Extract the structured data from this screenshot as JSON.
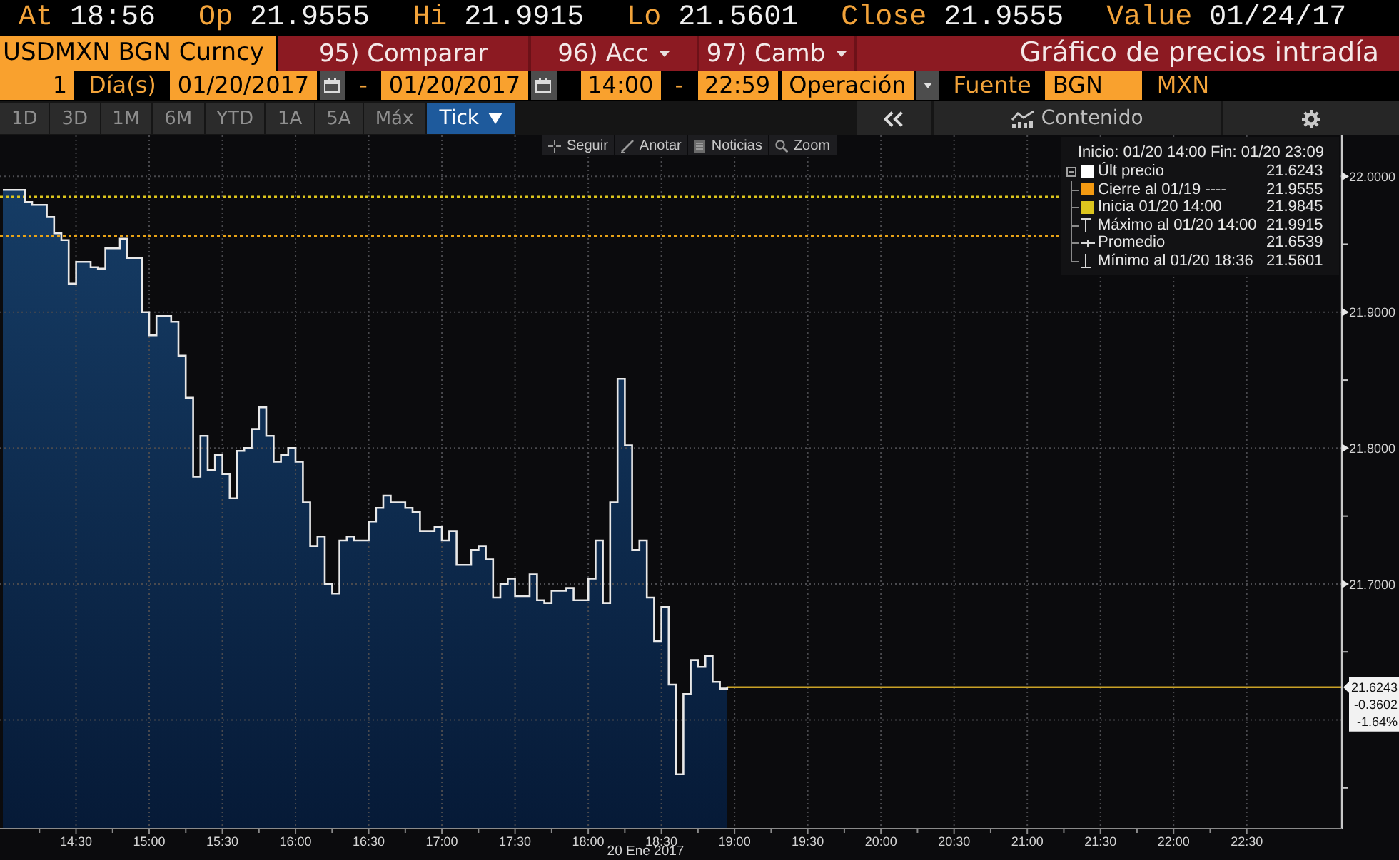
{
  "quote": [
    {
      "label": "At",
      "value": "18:56"
    },
    {
      "label": "Op",
      "value": "21.9555"
    },
    {
      "label": "Hi",
      "value": "21.9915"
    },
    {
      "label": "Lo",
      "value": "21.5601"
    },
    {
      "label": "Close",
      "value": "21.9555"
    },
    {
      "label": "Value",
      "value": "01/24/17"
    }
  ],
  "header": {
    "security": "USDMXN BGN Curncy",
    "menu": [
      {
        "label": "95) Comparar",
        "dropdown": false
      },
      {
        "label": "96) Acc",
        "dropdown": true
      },
      {
        "label": "97) Camb",
        "dropdown": true
      }
    ],
    "title": "Gráfico de precios intradía"
  },
  "range_bar": [
    {
      "kind": "field",
      "text": "1"
    },
    {
      "kind": "label",
      "text": "Día(s)"
    },
    {
      "kind": "date",
      "text": "01/20/2017"
    },
    {
      "kind": "label",
      "text": "-"
    },
    {
      "kind": "date",
      "text": "01/20/2017"
    },
    {
      "kind": "field",
      "text": "14:00"
    },
    {
      "kind": "label",
      "text": "-"
    },
    {
      "kind": "field",
      "text": "22:59"
    },
    {
      "kind": "select",
      "text": "Operación"
    },
    {
      "kind": "label",
      "text": "Fuente"
    },
    {
      "kind": "field",
      "text": "BGN"
    },
    {
      "kind": "label",
      "text": "MXN"
    }
  ],
  "periods": [
    {
      "label": "1D",
      "selected": false,
      "dropdown": false
    },
    {
      "label": "3D",
      "selected": false,
      "dropdown": false
    },
    {
      "label": "1M",
      "selected": false,
      "dropdown": false
    },
    {
      "label": "6M",
      "selected": false,
      "dropdown": false
    },
    {
      "label": "YTD",
      "selected": false,
      "dropdown": false
    },
    {
      "label": "1A",
      "selected": false,
      "dropdown": false
    },
    {
      "label": "5A",
      "selected": false,
      "dropdown": false
    },
    {
      "label": "Máx",
      "selected": false,
      "dropdown": false
    },
    {
      "label": "Tick",
      "selected": true,
      "dropdown": true
    }
  ],
  "view_bar": {
    "content_button": "Contenido"
  },
  "chart": {
    "tools": [
      {
        "kind": "follow",
        "label": "Seguir"
      },
      {
        "kind": "annotate",
        "label": "Anotar"
      },
      {
        "kind": "news",
        "label": "Noticias"
      },
      {
        "kind": "zoom",
        "label": "Zoom"
      }
    ],
    "legend": {
      "header": "Inicio: 01/20 14:00 Fin: 01/20 23:09",
      "items": [
        {
          "kind": "swatch",
          "color": "#ffffff",
          "label": "Últ precio",
          "value": "21.6243"
        },
        {
          "kind": "swatch",
          "color": "#f39a12",
          "label": "Cierre al 01/19 ----",
          "value": "21.9555"
        },
        {
          "kind": "swatch",
          "color": "#dcc51e",
          "label": "Inicia 01/20 14:00",
          "value": "21.9845"
        },
        {
          "kind": "high",
          "label": "Máximo al 01/20 14:00",
          "value": "21.9915"
        },
        {
          "kind": "average",
          "label": "Promedio",
          "value": "21.6539"
        },
        {
          "kind": "low",
          "label": "Mínimo al 01/20 18:36",
          "value": "21.5601"
        }
      ]
    },
    "last_price_tag": [
      "21.6243",
      "-0.3602",
      "-1.64%"
    ],
    "chart_data": {
      "type": "area",
      "xlabel": "20 Ene 2017",
      "categories": [
        null,
        null,
        null,
        null,
        null,
        null,
        null,
        null,
        null,
        null,
        "14:30",
        null,
        null,
        null,
        null,
        null,
        null,
        null,
        null,
        null,
        "15:00",
        null,
        null,
        null,
        null,
        null,
        null,
        null,
        null,
        null,
        "15:30",
        null,
        null,
        null,
        null,
        null,
        null,
        null,
        null,
        null,
        "16:00",
        null,
        null,
        null,
        null,
        null,
        null,
        null,
        null,
        null,
        "16:30",
        null,
        null,
        null,
        null,
        null,
        null,
        null,
        null,
        null,
        "17:00",
        null,
        null,
        null,
        null,
        null,
        null,
        null,
        null,
        null,
        "17:30",
        null,
        null,
        null,
        null,
        null,
        null,
        null,
        null,
        null,
        "18:00",
        null,
        null,
        null,
        null,
        null,
        null,
        null,
        null,
        null,
        "18:30",
        null,
        null,
        null,
        null,
        null,
        null,
        null,
        null,
        null,
        "19:00",
        null,
        null,
        null,
        null,
        null,
        null,
        null,
        null,
        null,
        "19:30",
        null,
        null,
        null,
        null,
        null,
        null,
        null,
        null,
        null,
        "20:00",
        null,
        null,
        null,
        null,
        null,
        null,
        null,
        null,
        null,
        "20:30",
        null,
        null,
        null,
        null,
        null,
        null,
        null,
        null,
        null,
        "21:00",
        null,
        null,
        null,
        null,
        null,
        null,
        null,
        null,
        null,
        "21:30",
        null,
        null,
        null,
        null,
        null,
        null,
        null,
        null,
        null,
        "22:00",
        null,
        null,
        null,
        null,
        null,
        null,
        null,
        null,
        null,
        "22:30",
        null,
        null,
        null,
        null,
        null,
        null,
        null,
        null,
        null,
        null,
        null,
        null,
        null
      ],
      "series": [
        {
          "color": "#e8e8e8",
          "values": [
            21.99,
            21.99,
            21.99,
            21.981,
            21.979,
            21.979,
            21.97,
            21.958,
            21.953,
            21.921,
            21.937,
            21.937,
            21.933,
            21.932,
            21.947,
            21.947,
            21.954,
            21.94,
            21.94,
            21.9,
            21.883,
            21.897,
            21.897,
            21.893,
            21.868,
            21.837,
            21.779,
            21.809,
            21.784,
            21.795,
            21.781,
            21.763,
            21.798,
            21.8,
            21.814,
            21.83,
            21.809,
            21.79,
            21.795,
            21.8,
            21.79,
            21.76,
            21.728,
            21.735,
            21.7,
            21.693,
            21.732,
            21.735,
            21.732,
            21.732,
            21.746,
            21.756,
            21.765,
            21.76,
            21.76,
            21.756,
            21.753,
            21.739,
            21.739,
            21.742,
            21.732,
            21.739,
            21.714,
            21.714,
            21.725,
            21.728,
            21.718,
            21.69,
            21.7,
            21.704,
            21.691,
            21.691,
            21.707,
            21.688,
            21.686,
            21.695,
            21.695,
            21.697,
            21.688,
            21.688,
            21.704,
            21.732,
            21.686,
            21.76,
            21.851,
            21.802,
            21.725,
            21.732,
            21.69,
            21.658,
            21.683,
            21.626,
            21.56,
            21.619,
            21.644,
            21.639,
            21.647,
            21.628,
            21.623,
            21.624,
            null,
            null,
            null,
            null,
            null,
            null,
            null,
            null,
            null,
            null,
            null,
            null,
            null,
            null,
            null,
            null,
            null,
            null,
            null,
            null,
            null,
            null,
            null,
            null,
            null,
            null,
            null,
            null,
            null,
            null,
            null,
            null,
            null,
            null,
            null,
            null,
            null,
            null,
            null,
            null,
            null,
            null,
            null,
            null,
            null,
            null,
            null,
            null,
            null,
            null,
            null,
            null,
            null,
            null,
            null,
            null,
            null,
            null,
            null,
            null,
            null,
            null,
            null,
            null,
            null,
            null,
            null,
            null,
            null,
            null,
            null,
            null,
            null,
            null,
            null,
            null,
            null,
            null,
            null,
            null,
            null,
            null,
            null,
            null
          ]
        }
      ],
      "ylim": [
        21.52,
        22.03
      ],
      "yticks": [
        {
          "value": 22,
          "label": "22.0000"
        },
        {
          "value": 21.9,
          "label": "21.9000"
        },
        {
          "value": 21.8,
          "label": "21.8000"
        },
        {
          "value": 21.7,
          "label": "21.7000"
        }
      ],
      "grid": true,
      "ref_lines": [
        {
          "axis": "y",
          "value": 21.985,
          "color": "#dcc51e"
        },
        {
          "axis": "y",
          "value": 21.956,
          "color": "#e8a317"
        }
      ]
    }
  }
}
